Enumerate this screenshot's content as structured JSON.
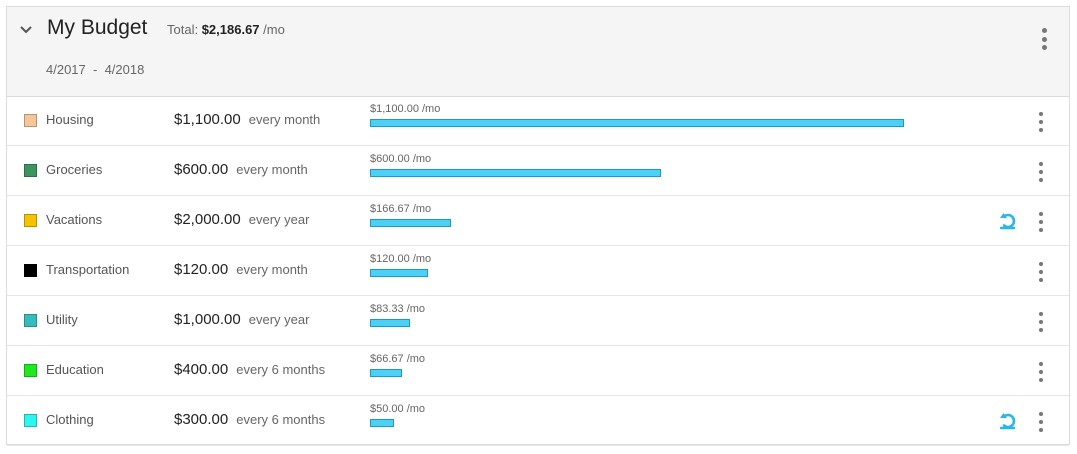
{
  "budget": {
    "title": "My Budget",
    "total_label": "Total:",
    "total_amount": "$2,186.67",
    "total_unit": "/mo",
    "range_start": "4/2017",
    "range_sep": "-",
    "range_end": "4/2018"
  },
  "colors": {
    "bar_fill": "#4dd0f5",
    "bar_border": "#1a9bc4",
    "recurring_icon": "#29b6e8"
  },
  "categories": [
    {
      "name": "Housing",
      "color": "#f5c69a",
      "amount": "$1,100.00",
      "frequency": "every month",
      "monthly_label": "$1,100.00 /mo",
      "monthly": 1100.0,
      "recurring_icon": false
    },
    {
      "name": "Groceries",
      "color": "#3a9560",
      "amount": "$600.00",
      "frequency": "every month",
      "monthly_label": "$600.00 /mo",
      "monthly": 600.0,
      "recurring_icon": false
    },
    {
      "name": "Vacations",
      "color": "#f5c400",
      "amount": "$2,000.00",
      "frequency": "every year",
      "monthly_label": "$166.67 /mo",
      "monthly": 166.67,
      "recurring_icon": true
    },
    {
      "name": "Transportation",
      "color": "#000000",
      "amount": "$120.00",
      "frequency": "every month",
      "monthly_label": "$120.00 /mo",
      "monthly": 120.0,
      "recurring_icon": false
    },
    {
      "name": "Utility",
      "color": "#35bcbc",
      "amount": "$1,000.00",
      "frequency": "every year",
      "monthly_label": "$83.33 /mo",
      "monthly": 83.33,
      "recurring_icon": false
    },
    {
      "name": "Education",
      "color": "#1ee81e",
      "amount": "$400.00",
      "frequency": "every 6 months",
      "monthly_label": "$66.67 /mo",
      "monthly": 66.67,
      "recurring_icon": false
    },
    {
      "name": "Clothing",
      "color": "#2ff5f0",
      "amount": "$300.00",
      "frequency": "every 6 months",
      "monthly_label": "$50.00 /mo",
      "monthly": 50.0,
      "recurring_icon": true
    }
  ]
}
